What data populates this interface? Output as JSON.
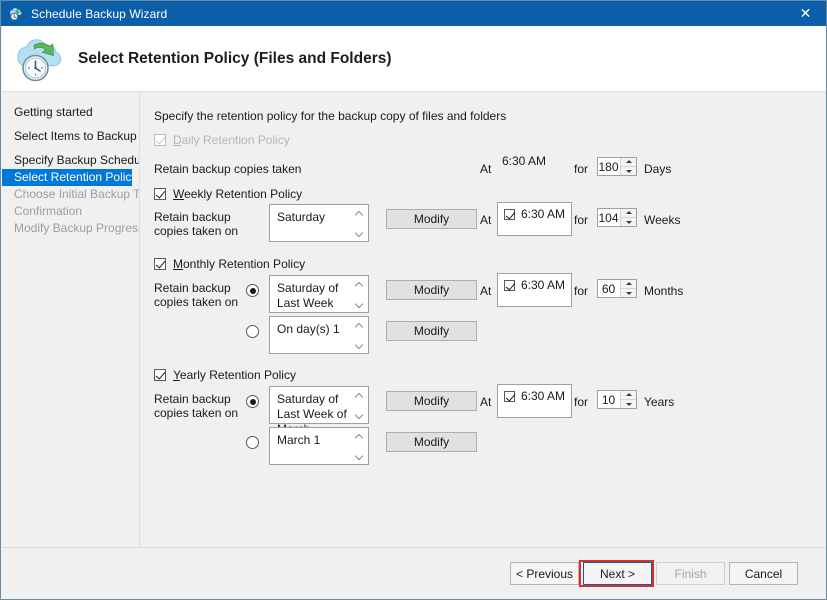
{
  "window": {
    "title": "Schedule Backup Wizard",
    "title_icon": "backup-wizard-icon",
    "close_icon": "close-icon",
    "accent_color": "#0b5ea8",
    "selection_color": "#0078d7",
    "highlight_color": "#d93025"
  },
  "header": {
    "icon": "cloud-clock-backup-icon",
    "title": "Select Retention Policy (Files and Folders)"
  },
  "sidebar": {
    "items": [
      {
        "label": "Getting started",
        "state": "normal"
      },
      {
        "label": "Select Items to Backup",
        "state": "normal"
      },
      {
        "label": "Specify Backup Schedu...",
        "state": "normal"
      },
      {
        "label": "Select Retention Policy ...",
        "state": "selected"
      },
      {
        "label": "Choose Initial Backup T...",
        "state": "dim"
      },
      {
        "label": "Confirmation",
        "state": "dim"
      },
      {
        "label": "Modify Backup Progress",
        "state": "dim"
      }
    ]
  },
  "content": {
    "intro": "Specify the retention policy for the backup copy of files and folders",
    "labels": {
      "at": "At",
      "for": "for",
      "retain_taken": "Retain backup copies taken",
      "retain_taken_on_line1": "Retain backup",
      "retain_taken_on_line2": "copies taken on",
      "modify": "Modify"
    },
    "daily": {
      "checkbox_label": "Daily Retention Policy",
      "checked": true,
      "enabled": false,
      "time": "6:30 AM",
      "duration": "180",
      "unit": "Days"
    },
    "weekly": {
      "checkbox_label": "Weekly Retention Policy",
      "checked": true,
      "enabled": true,
      "selection": "Saturday",
      "modify_label": "Modify",
      "time": "6:30 AM",
      "time_checked": true,
      "duration": "104",
      "unit": "Weeks"
    },
    "monthly": {
      "checkbox_label": "Monthly Retention Policy",
      "checked": true,
      "enabled": true,
      "option1_selected": true,
      "option1_selection": "Saturday of Last Week",
      "option1_modify_label": "Modify",
      "option2_selected": false,
      "option2_selection": "On day(s) 1",
      "option2_modify_label": "Modify",
      "time": "6:30 AM",
      "time_checked": true,
      "duration": "60",
      "unit": "Months"
    },
    "yearly": {
      "checkbox_label": "Yearly Retention Policy",
      "checked": true,
      "enabled": true,
      "option1_selected": true,
      "option1_selection": "Saturday of Last Week of March",
      "option1_modify_label": "Modify",
      "option2_selected": false,
      "option2_selection": "March 1",
      "option2_modify_label": "Modify",
      "time": "6:30 AM",
      "time_checked": true,
      "duration": "10",
      "unit": "Years"
    }
  },
  "footer": {
    "previous": "< Previous",
    "next": "Next >",
    "finish": "Finish",
    "cancel": "Cancel",
    "finish_disabled": true,
    "next_focused": true
  }
}
